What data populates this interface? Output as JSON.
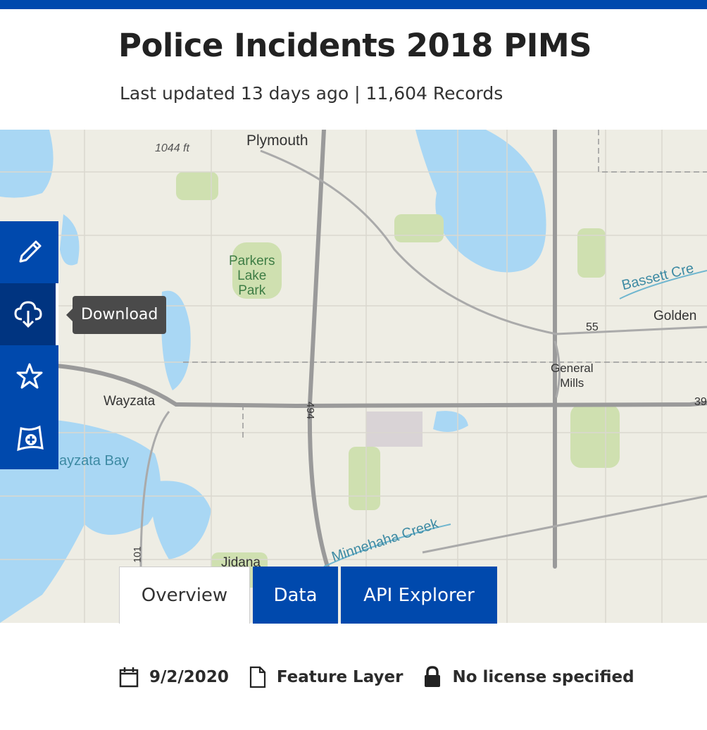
{
  "header": {
    "title": "Police Incidents 2018 PIMS",
    "subtitle": "Last updated 13 days ago | 11,604 Records",
    "accent": "#0049ad"
  },
  "map": {
    "labels": {
      "plymouth": "Plymouth",
      "elevation": "1044 ft",
      "park": "Parkers\nLake\nPark",
      "bassett": "Bassett Cre",
      "golden": "Golden",
      "hwy55": "55",
      "general_mills": "General\nMills",
      "wayzata": "Wayzata",
      "hwy494": "494",
      "hwy394": "39",
      "wayzata_bay": "ayzata Bay",
      "minnehaha": "Minnehaha Creek",
      "jidana": "Jidana",
      "hwy101": "101"
    }
  },
  "toolbar": {
    "items": [
      {
        "icon": "pencil-icon"
      },
      {
        "icon": "cloud-download-icon",
        "active": true
      },
      {
        "icon": "star-icon"
      },
      {
        "icon": "map-add-icon"
      }
    ],
    "tooltip": "Download"
  },
  "tabs": [
    {
      "label": "Overview",
      "active": true
    },
    {
      "label": "Data"
    },
    {
      "label": "API Explorer"
    }
  ],
  "meta": {
    "date": "9/2/2020",
    "type": "Feature Layer",
    "license": "No license specified"
  }
}
